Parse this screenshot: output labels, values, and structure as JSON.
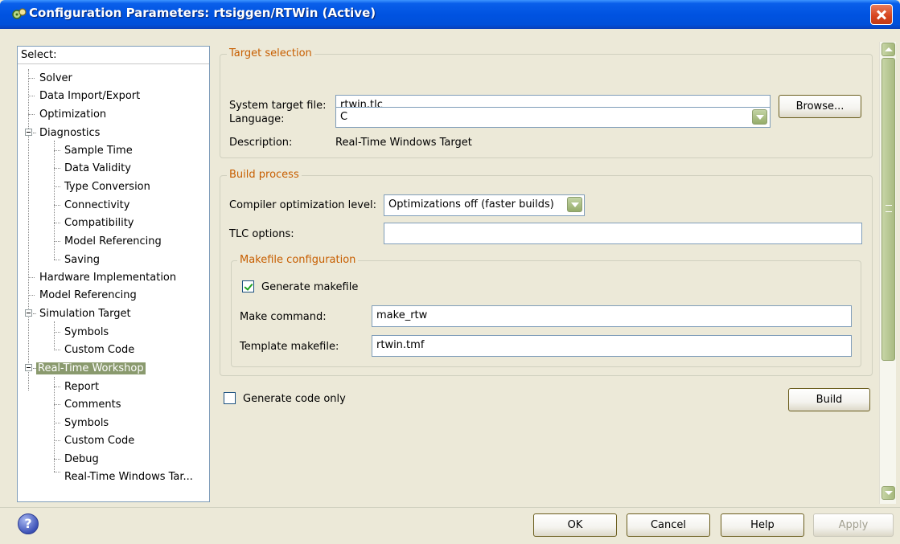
{
  "window": {
    "title": "Configuration Parameters: rtsiggen/RTWin (Active)"
  },
  "tree": {
    "header": "Select:",
    "items": [
      {
        "label": "Solver"
      },
      {
        "label": "Data Import/Export"
      },
      {
        "label": "Optimization"
      },
      {
        "label": "Diagnostics"
      },
      {
        "label": "Sample Time"
      },
      {
        "label": "Data Validity"
      },
      {
        "label": "Type Conversion"
      },
      {
        "label": "Connectivity"
      },
      {
        "label": "Compatibility"
      },
      {
        "label": "Model Referencing"
      },
      {
        "label": "Saving"
      },
      {
        "label": "Hardware Implementation"
      },
      {
        "label": "Model Referencing"
      },
      {
        "label": "Simulation Target"
      },
      {
        "label": "Symbols"
      },
      {
        "label": "Custom Code"
      },
      {
        "label": "Real-Time Workshop"
      },
      {
        "label": "Report"
      },
      {
        "label": "Comments"
      },
      {
        "label": "Symbols"
      },
      {
        "label": "Custom Code"
      },
      {
        "label": "Debug"
      },
      {
        "label": "Real-Time Windows Tar..."
      }
    ],
    "selected": "Real-Time Workshop"
  },
  "target_selection": {
    "legend": "Target selection",
    "system_target_label": "System target file:",
    "system_target_value": "rtwin.tlc",
    "browse_label": "Browse...",
    "language_label": "Language:",
    "language_value": "C",
    "description_label": "Description:",
    "description_value": "Real-Time Windows Target"
  },
  "build_process": {
    "legend": "Build process",
    "compiler_opt_label": "Compiler optimization level:",
    "compiler_opt_value": "Optimizations off (faster builds)",
    "tlc_options_label": "TLC options:",
    "tlc_options_value": "",
    "makefile": {
      "legend": "Makefile configuration",
      "generate_label": "Generate makefile",
      "generate_checked": true,
      "make_command_label": "Make command:",
      "make_command_value": "make_rtw",
      "template_label": "Template makefile:",
      "template_value": "rtwin.tmf"
    }
  },
  "generate_code_only": {
    "label": "Generate code only",
    "checked": false
  },
  "buttons": {
    "build": "Build",
    "ok": "OK",
    "cancel": "Cancel",
    "help": "Help",
    "apply": "Apply"
  },
  "icons": {
    "title": "simulink-gear-icon",
    "close": "close-icon",
    "help": "question-icon",
    "combo": "chevron-down-icon"
  }
}
